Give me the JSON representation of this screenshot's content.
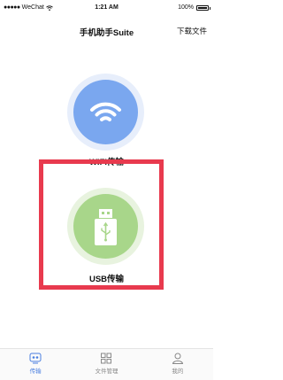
{
  "status_bar": {
    "carrier": "WeChat",
    "time": "1:21 AM",
    "battery_text": "100%",
    "battery_level": 1.0
  },
  "nav": {
    "title": "手机助手Suite",
    "download_label": "下载文件"
  },
  "cards": {
    "wifi": {
      "label": "WIFI传输",
      "icon": "wifi-icon",
      "color": "#7aa7ef"
    },
    "usb": {
      "label": "USB传输",
      "icon": "usb-drive-icon",
      "color": "#a8d68a"
    }
  },
  "highlight": {
    "color": "#e83a4e"
  },
  "tabs": [
    {
      "label": "传输",
      "icon": "transfer-icon",
      "active": true
    },
    {
      "label": "文件管理",
      "icon": "file-manage-icon",
      "active": false
    },
    {
      "label": "我的",
      "icon": "profile-icon",
      "active": false
    }
  ]
}
